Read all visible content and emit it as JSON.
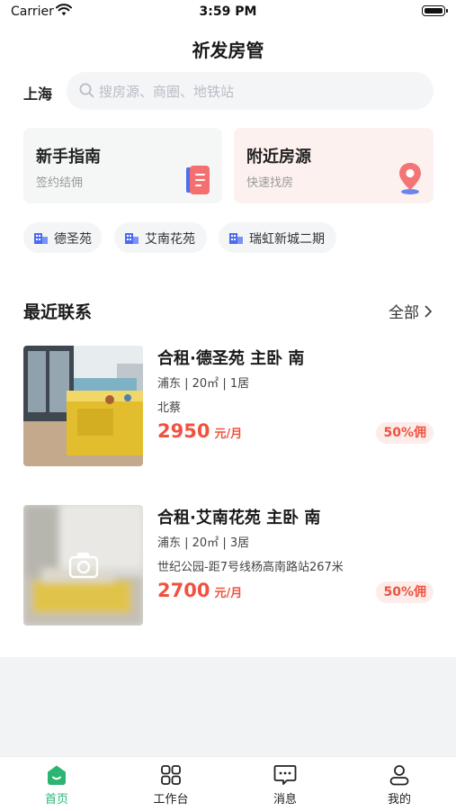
{
  "status_bar": {
    "carrier": "Carrier",
    "time": "3:59 PM"
  },
  "header": {
    "title": "祈发房管"
  },
  "search": {
    "city": "上海",
    "placeholder": "搜房源、商圈、地铁站"
  },
  "cards": [
    {
      "title": "新手指南",
      "subtitle": "签约结佣",
      "icon": "document-icon"
    },
    {
      "title": "附近房源",
      "subtitle": "快速找房",
      "icon": "location-pin-icon"
    }
  ],
  "chips": [
    "德圣苑",
    "艾南花苑",
    "瑞虹新城二期"
  ],
  "recent": {
    "title": "最近联系",
    "more": "全部"
  },
  "listings": [
    {
      "title": "合租·德圣苑 主卧 南",
      "meta": "浦东 | 20㎡ | 1居",
      "location": "北蔡",
      "price": "2950",
      "unit": "元/月",
      "commission": "50%佣"
    },
    {
      "title": "合租·艾南花苑 主卧 南",
      "meta": "浦东 | 20㎡ | 3居",
      "location": "世纪公园-距7号线杨高南路站267米",
      "price": "2700",
      "unit": "元/月",
      "commission": "50%佣"
    }
  ],
  "tabs": [
    {
      "label": "首页",
      "icon": "home-icon",
      "active": true
    },
    {
      "label": "工作台",
      "icon": "grid-icon",
      "active": false
    },
    {
      "label": "消息",
      "icon": "message-icon",
      "active": false
    },
    {
      "label": "我的",
      "icon": "user-icon",
      "active": false
    }
  ],
  "colors": {
    "accent": "#2bb573",
    "price": "#f0523f",
    "commission_bg": "#fdecea"
  }
}
